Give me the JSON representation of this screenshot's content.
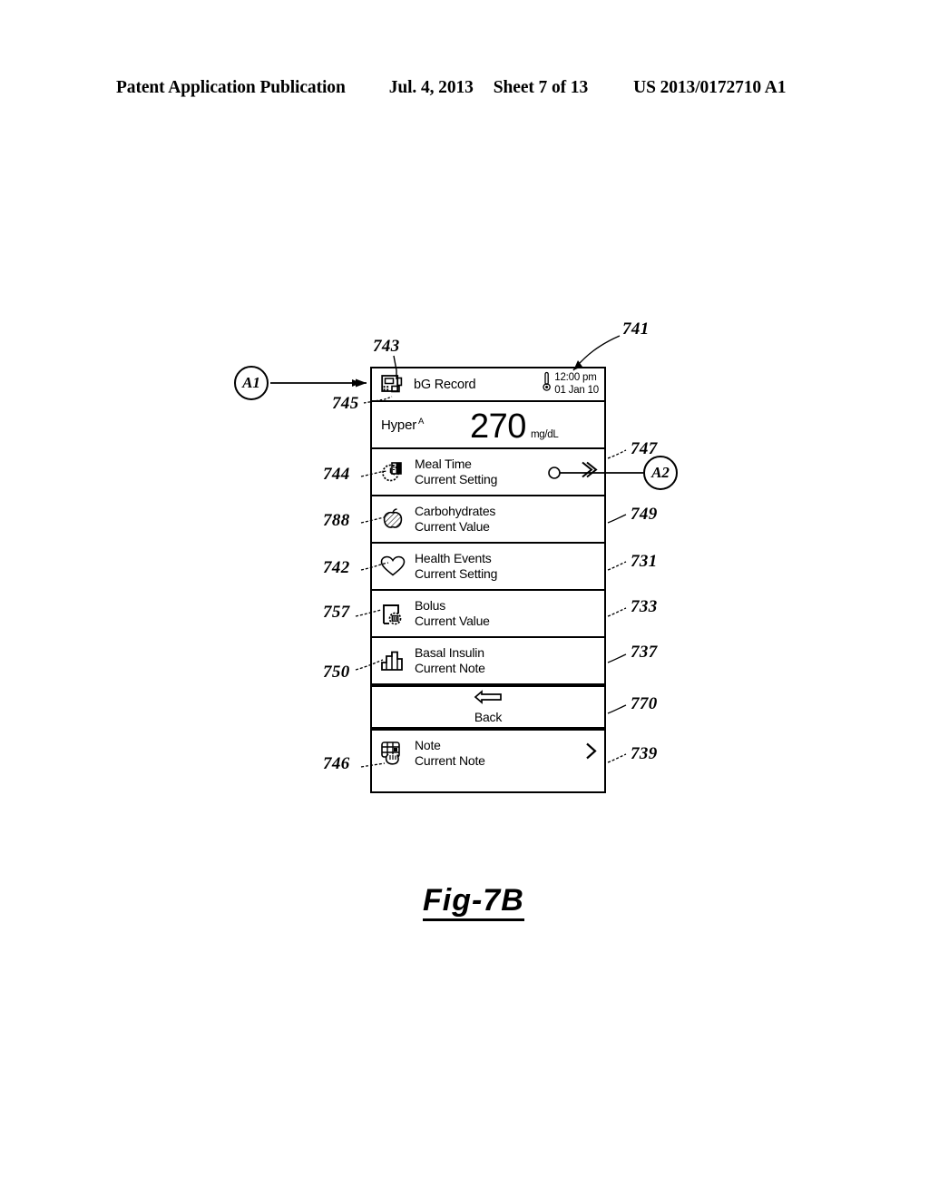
{
  "page_header": {
    "publication": "Patent Application Publication",
    "date": "Jul. 4, 2013",
    "sheet": "Sheet 7 of 13",
    "patent_number": "US 2013/0172710 A1"
  },
  "figure": {
    "caption": "Fig-7B"
  },
  "device": {
    "titlebar": {
      "icon": "meter-device-icon",
      "title": "bG Record",
      "status_icon": "thermometer-icon",
      "time": "12:00 pm",
      "date": "01 Jan 10"
    },
    "reading": {
      "status": "Hyper",
      "status_marker": "A",
      "value": "270",
      "units": "mg/dL"
    },
    "menu_items": [
      {
        "icon": "meal-time-clock-icon",
        "label": "Meal Time",
        "sublabel": "Current Setting",
        "chevron": true
      },
      {
        "icon": "apple-carbohydrates-icon",
        "label": "Carbohydrates",
        "sublabel": "Current Value",
        "chevron": false
      },
      {
        "icon": "heart-health-events-icon",
        "label": "Health Events",
        "sublabel": "Current Setting",
        "chevron": false
      },
      {
        "icon": "bolus-pen-icon",
        "label": "Bolus",
        "sublabel": "Current Value",
        "chevron": false
      },
      {
        "icon": "basal-insulin-bars-icon",
        "label": "Basal Insulin",
        "sublabel": "Current Note",
        "chevron": false
      }
    ],
    "back": {
      "icon": "left-arrow-icon",
      "label": "Back"
    },
    "note_item": {
      "icon": "note-hand-icon",
      "label": "Note",
      "sublabel": "Current Note",
      "chevron": true
    }
  },
  "callouts": {
    "n741": "741",
    "n743": "743",
    "n745": "745",
    "n744": "744",
    "n788": "788",
    "n742": "742",
    "n757": "757",
    "n750": "750",
    "n746": "746",
    "n747": "747",
    "n749": "749",
    "n731": "731",
    "n733": "733",
    "n737": "737",
    "n770": "770",
    "n739": "739",
    "bubble_a1": "A1",
    "bubble_a2": "A2"
  }
}
